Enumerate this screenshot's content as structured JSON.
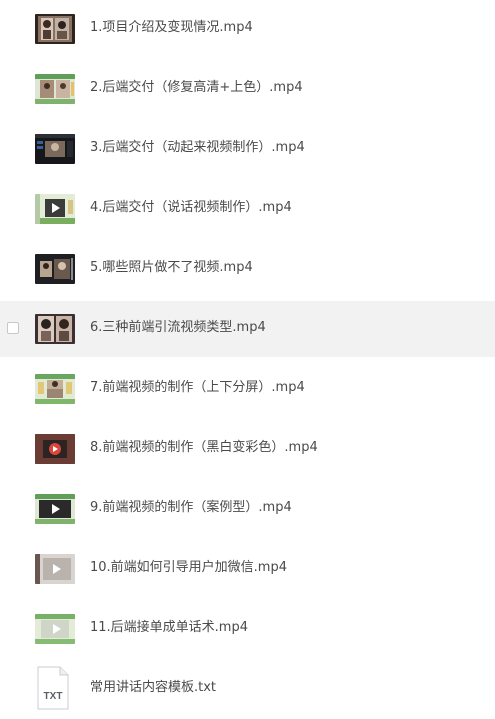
{
  "files": [
    {
      "name": "1.项目介绍及变现情况.mp4",
      "icon": "video-thumbnail-icon",
      "thumb": "portrait"
    },
    {
      "name": "2.后端交付（修复高清+上色）.mp4",
      "icon": "video-thumbnail-icon",
      "thumb": "collage"
    },
    {
      "name": "3.后端交付（动起来视频制作）.mp4",
      "icon": "video-thumbnail-icon",
      "thumb": "dark-editor"
    },
    {
      "name": "4.后端交付（说话视频制作）.mp4",
      "icon": "video-thumbnail-icon",
      "thumb": "play-green"
    },
    {
      "name": "5.哪些照片做不了视频.mp4",
      "icon": "video-thumbnail-icon",
      "thumb": "dark-photos"
    },
    {
      "name": "6.三种前端引流视频类型.mp4",
      "icon": "video-thumbnail-icon",
      "thumb": "portrait-pair"
    },
    {
      "name": "7.前端视频的制作（上下分屏）.mp4",
      "icon": "video-thumbnail-icon",
      "thumb": "split-green"
    },
    {
      "name": "8.前端视频的制作（黑白变彩色）.mp4",
      "icon": "video-thumbnail-icon",
      "thumb": "play-red"
    },
    {
      "name": "9.前端视频的制作（案例型）.mp4",
      "icon": "video-thumbnail-icon",
      "thumb": "play-dark-green"
    },
    {
      "name": "10.前端如何引导用户加微信.mp4",
      "icon": "video-thumbnail-icon",
      "thumb": "play-light"
    },
    {
      "name": "11.后端接单成单话术.mp4",
      "icon": "video-thumbnail-icon",
      "thumb": "play-light-green"
    },
    {
      "name": "常用讲话内容模板.txt",
      "icon": "txt-file-icon",
      "icon_label": "TXT",
      "thumb": "txt"
    }
  ],
  "hovered_index": 5,
  "colors": {
    "hover_bg": "#f2f2f3",
    "text": "#4a4a4a",
    "txt_label": "#5a5f66"
  }
}
